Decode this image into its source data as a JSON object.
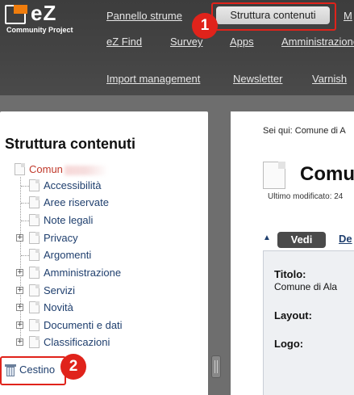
{
  "header": {
    "logo": {
      "text": "eZ",
      "subtitle": "Community Project"
    },
    "nav_row1": [
      "Pannello strume",
      "Struttura contenuti",
      "M"
    ],
    "nav_row2": [
      "eZ Find",
      "Survey",
      "Apps",
      "Amministrazione"
    ],
    "nav_row3": [
      "Import management",
      "Newsletter",
      "Varnish"
    ],
    "callout_1": "1"
  },
  "left_panel": {
    "title": "Struttura contenuti",
    "root": "Comun",
    "items": [
      {
        "label": "Accessibilità",
        "expandable": false
      },
      {
        "label": "Aree riservate",
        "expandable": false
      },
      {
        "label": "Note legali",
        "expandable": false
      },
      {
        "label": "Privacy",
        "expandable": true
      },
      {
        "label": "Argomenti",
        "expandable": false
      },
      {
        "label": "Amministrazione",
        "expandable": true
      },
      {
        "label": "Servizi",
        "expandable": true
      },
      {
        "label": "Novità",
        "expandable": true
      },
      {
        "label": "Documenti e dati",
        "expandable": true
      },
      {
        "label": "Classificazioni",
        "expandable": true
      }
    ],
    "trash": "Cestino",
    "callout_2": "2"
  },
  "right_panel": {
    "breadcrumb": "Sei qui: Comune di A",
    "title": "Comu",
    "modified": "Ultimo modificato: 24",
    "view_button": "Vedi",
    "next_tab": "De",
    "fields": [
      {
        "label": "Titolo:",
        "value": "Comune di Ala"
      },
      {
        "label": "Layout:",
        "value": ""
      },
      {
        "label": "Logo:",
        "value": ""
      }
    ]
  },
  "colors": {
    "header_bg": "#444444",
    "accent_red": "#e0231b",
    "logo_orange": "#f07d0d",
    "link_blue": "#1f3f6e"
  }
}
